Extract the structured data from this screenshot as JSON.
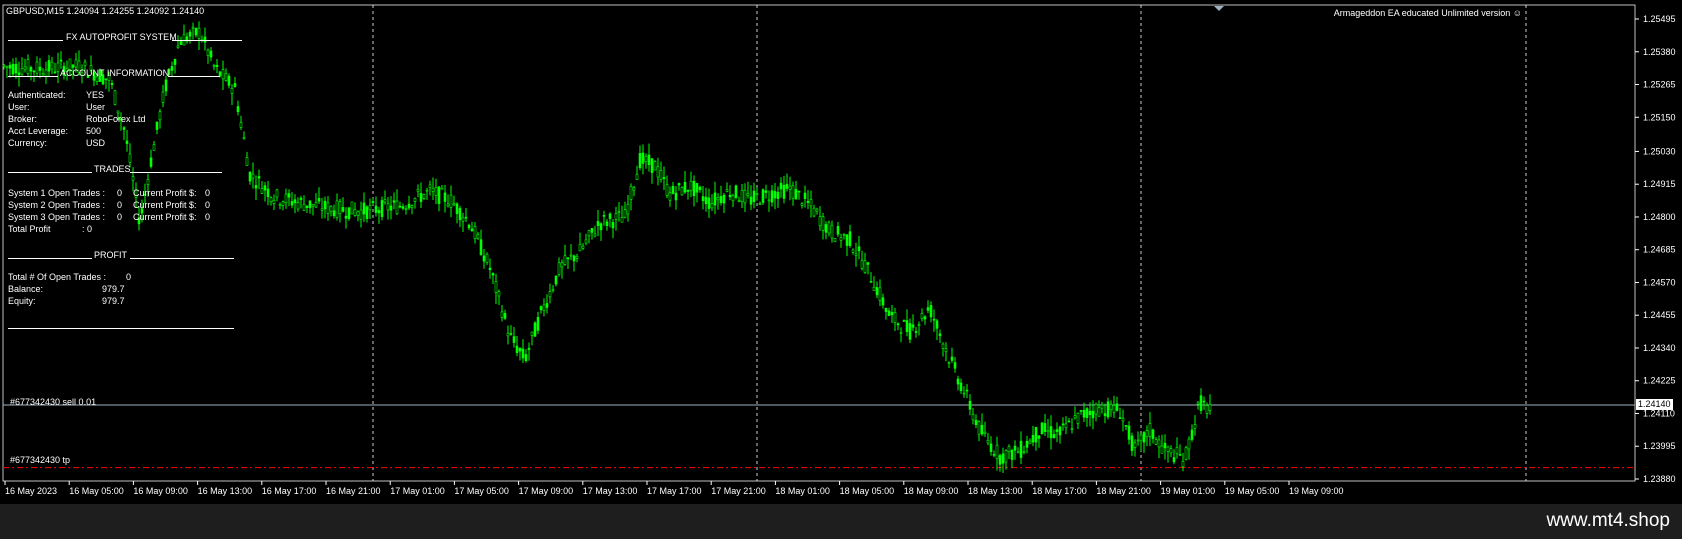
{
  "header": {
    "symbol_info": "GBPUSD,M15  1.24094 1.24255 1.24092 1.24140",
    "ea_banner": "Armageddon EA educated Unlimited version ☺"
  },
  "panel": {
    "title_system": "FX AUTOPROFIT SYSTEM",
    "title_account": "ACCOUNT INFORMATION",
    "account": [
      {
        "label": "Authenticated:",
        "value": "YES"
      },
      {
        "label": "User:",
        "value": "User"
      },
      {
        "label": "Broker:",
        "value": "RoboForex Ltd"
      },
      {
        "label": "Acct Leverage:",
        "value": "500"
      },
      {
        "label": "Currency:",
        "value": "USD"
      }
    ],
    "title_trades": "TRADES",
    "trades": [
      {
        "label": "System 1 Open Trades :",
        "count": "0",
        "profit_label": "Current Profit $:",
        "profit": "0"
      },
      {
        "label": "System 2 Open Trades :",
        "count": "0",
        "profit_label": "Current Profit $:",
        "profit": "0"
      },
      {
        "label": "System 3 Open Trades :",
        "count": "0",
        "profit_label": "Current Profit $:",
        "profit": "0"
      }
    ],
    "total_profit_label": "Total Profit",
    "total_profit_value": ": 0",
    "title_profit": "PROFIT",
    "open_trades_label": "Total # Of Open Trades :",
    "open_trades_value": "0",
    "balance_label": "Balance:",
    "balance_value": "979.7",
    "equity_label": "Equity:",
    "equity_value": "979.7"
  },
  "order_lines": {
    "sell_label": "#677342430 sell 0.01",
    "tp_label": "#677342430 tp",
    "sell_price": 1.2414,
    "tp_price": 1.2392
  },
  "colors": {
    "candle": "#00ff00",
    "sell_line": "#00a000",
    "tp_line": "#ff0000",
    "grid": "#ffffff",
    "bid_line": "#9fb0c0"
  },
  "price_axis": {
    "labels": [
      "1.25495",
      "1.25380",
      "1.25265",
      "1.25150",
      "1.25030",
      "1.24915",
      "1.24800",
      "1.24685",
      "1.24570",
      "1.24455",
      "1.24340",
      "1.24225",
      "1.24110",
      "1.23995",
      "1.23880"
    ],
    "current_price": "1.24140",
    "min": 1.2388,
    "max": 1.25495
  },
  "time_axis": {
    "labels": [
      "16 May 2023",
      "16 May 05:00",
      "16 May 09:00",
      "16 May 13:00",
      "16 May 17:00",
      "16 May 21:00",
      "17 May 01:00",
      "17 May 05:00",
      "17 May 09:00",
      "17 May 13:00",
      "17 May 17:00",
      "17 May 21:00",
      "18 May 01:00",
      "18 May 05:00",
      "18 May 09:00",
      "18 May 13:00",
      "18 May 17:00",
      "18 May 21:00",
      "19 May 01:00",
      "19 May 05:00",
      "19 May 09:00"
    ]
  },
  "price_path": [
    [
      0,
      1.2533
    ],
    [
      40,
      1.2532
    ],
    [
      80,
      1.2533
    ],
    [
      110,
      1.2528
    ],
    [
      125,
      1.251
    ],
    [
      140,
      1.2478
    ],
    [
      150,
      1.2498
    ],
    [
      165,
      1.2525
    ],
    [
      180,
      1.2542
    ],
    [
      200,
      1.2545
    ],
    [
      215,
      1.2532
    ],
    [
      235,
      1.2525
    ],
    [
      250,
      1.2495
    ],
    [
      275,
      1.2487
    ],
    [
      300,
      1.2485
    ],
    [
      330,
      1.2483
    ],
    [
      360,
      1.2482
    ],
    [
      400,
      1.2484
    ],
    [
      430,
      1.2489
    ],
    [
      450,
      1.2486
    ],
    [
      470,
      1.2478
    ],
    [
      490,
      1.2462
    ],
    [
      510,
      1.2438
    ],
    [
      525,
      1.243
    ],
    [
      540,
      1.2445
    ],
    [
      560,
      1.2462
    ],
    [
      580,
      1.2468
    ],
    [
      600,
      1.2478
    ],
    [
      625,
      1.248
    ],
    [
      640,
      1.25
    ],
    [
      655,
      1.2498
    ],
    [
      670,
      1.2488
    ],
    [
      690,
      1.2491
    ],
    [
      710,
      1.2485
    ],
    [
      730,
      1.2489
    ],
    [
      750,
      1.2486
    ],
    [
      770,
      1.2488
    ],
    [
      790,
      1.249
    ],
    [
      810,
      1.2484
    ],
    [
      830,
      1.2475
    ],
    [
      850,
      1.2472
    ],
    [
      870,
      1.246
    ],
    [
      890,
      1.2445
    ],
    [
      910,
      1.244
    ],
    [
      930,
      1.2448
    ],
    [
      950,
      1.243
    ],
    [
      965,
      1.2418
    ],
    [
      980,
      1.2405
    ],
    [
      1000,
      1.2396
    ],
    [
      1020,
      1.2398
    ],
    [
      1040,
      1.2405
    ],
    [
      1060,
      1.2404
    ],
    [
      1080,
      1.241
    ],
    [
      1100,
      1.2413
    ],
    [
      1120,
      1.2412
    ],
    [
      1135,
      1.2398
    ],
    [
      1150,
      1.2405
    ],
    [
      1165,
      1.2398
    ],
    [
      1185,
      1.2395
    ],
    [
      1200,
      1.2415
    ],
    [
      1210,
      1.2412
    ]
  ]
}
